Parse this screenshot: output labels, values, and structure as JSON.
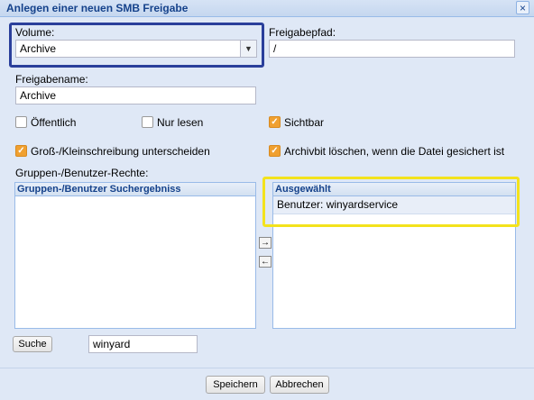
{
  "dialog": {
    "title": "Anlegen einer neuen SMB Freigabe",
    "close_symbol": "×"
  },
  "volume": {
    "label": "Volume:",
    "selected": "Archive",
    "arrow_icon": "chevron-down-icon"
  },
  "share_path": {
    "label": "Freigabepfad:",
    "value": "/"
  },
  "share_name": {
    "label": "Freigabename:",
    "value": "Archive"
  },
  "options": {
    "public": {
      "label": "Öffentlich",
      "checked": false
    },
    "read_only": {
      "label": "Nur lesen",
      "checked": false
    },
    "visible": {
      "label": "Sichtbar",
      "checked": true
    },
    "case_sensitive": {
      "label": "Groß-/Kleinschreibung unterscheiden",
      "checked": true
    },
    "archive_bit": {
      "label": "Archivbit löschen, wenn die Datei gesichert ist",
      "checked": true
    }
  },
  "rights": {
    "label": "Gruppen-/Benutzer-Rechte:",
    "search_results_header": "Gruppen-/Benutzer Suchergebniss",
    "search_results": [],
    "selected_header": "Ausgewählt",
    "selected_items": [
      "Benutzer: winyardservice"
    ]
  },
  "search": {
    "button_label": "Suche",
    "value": "winyard"
  },
  "footer": {
    "save_label": "Speichern",
    "cancel_label": "Abbrechen"
  },
  "colors": {
    "accent": "#f0a030",
    "title": "#15428b",
    "highlight_blue": "#2a3f9b",
    "highlight_yellow": "#f3e21c"
  }
}
